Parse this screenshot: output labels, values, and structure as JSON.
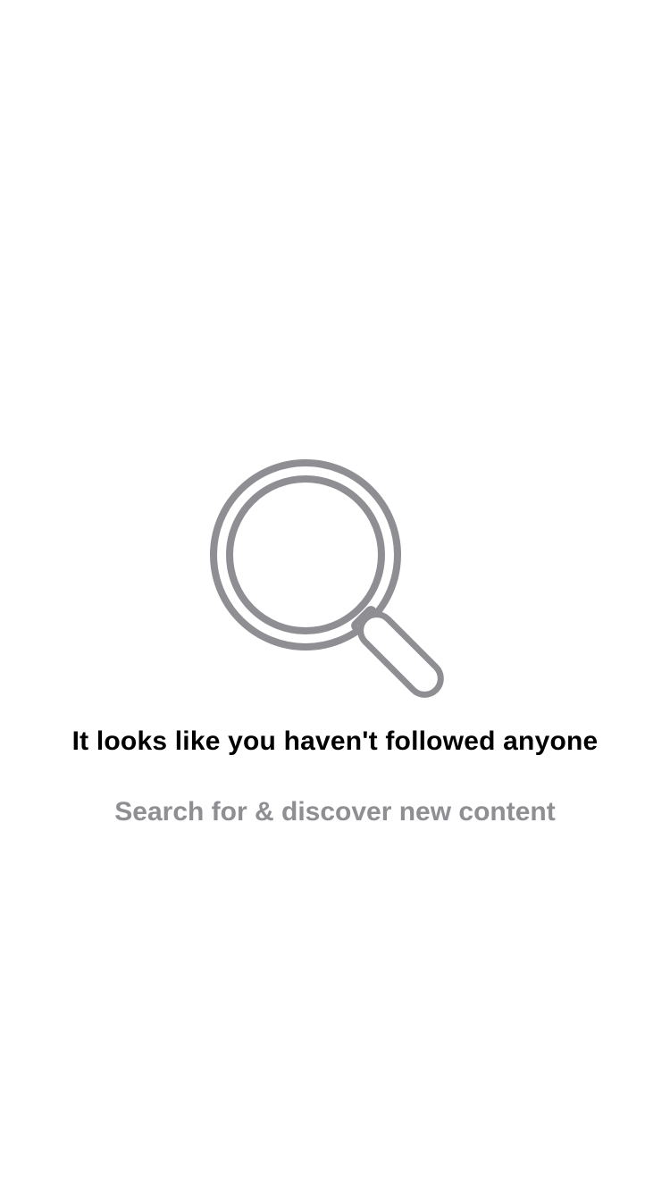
{
  "empty_state": {
    "icon": "magnifying-glass-icon",
    "title": "It looks like you haven't followed anyone",
    "subtitle": "Search for & discover new content"
  },
  "colors": {
    "background": "#ffffff",
    "title_text": "#000000",
    "subtitle_text": "#8e8e93",
    "icon_stroke": "#8e8e93"
  }
}
